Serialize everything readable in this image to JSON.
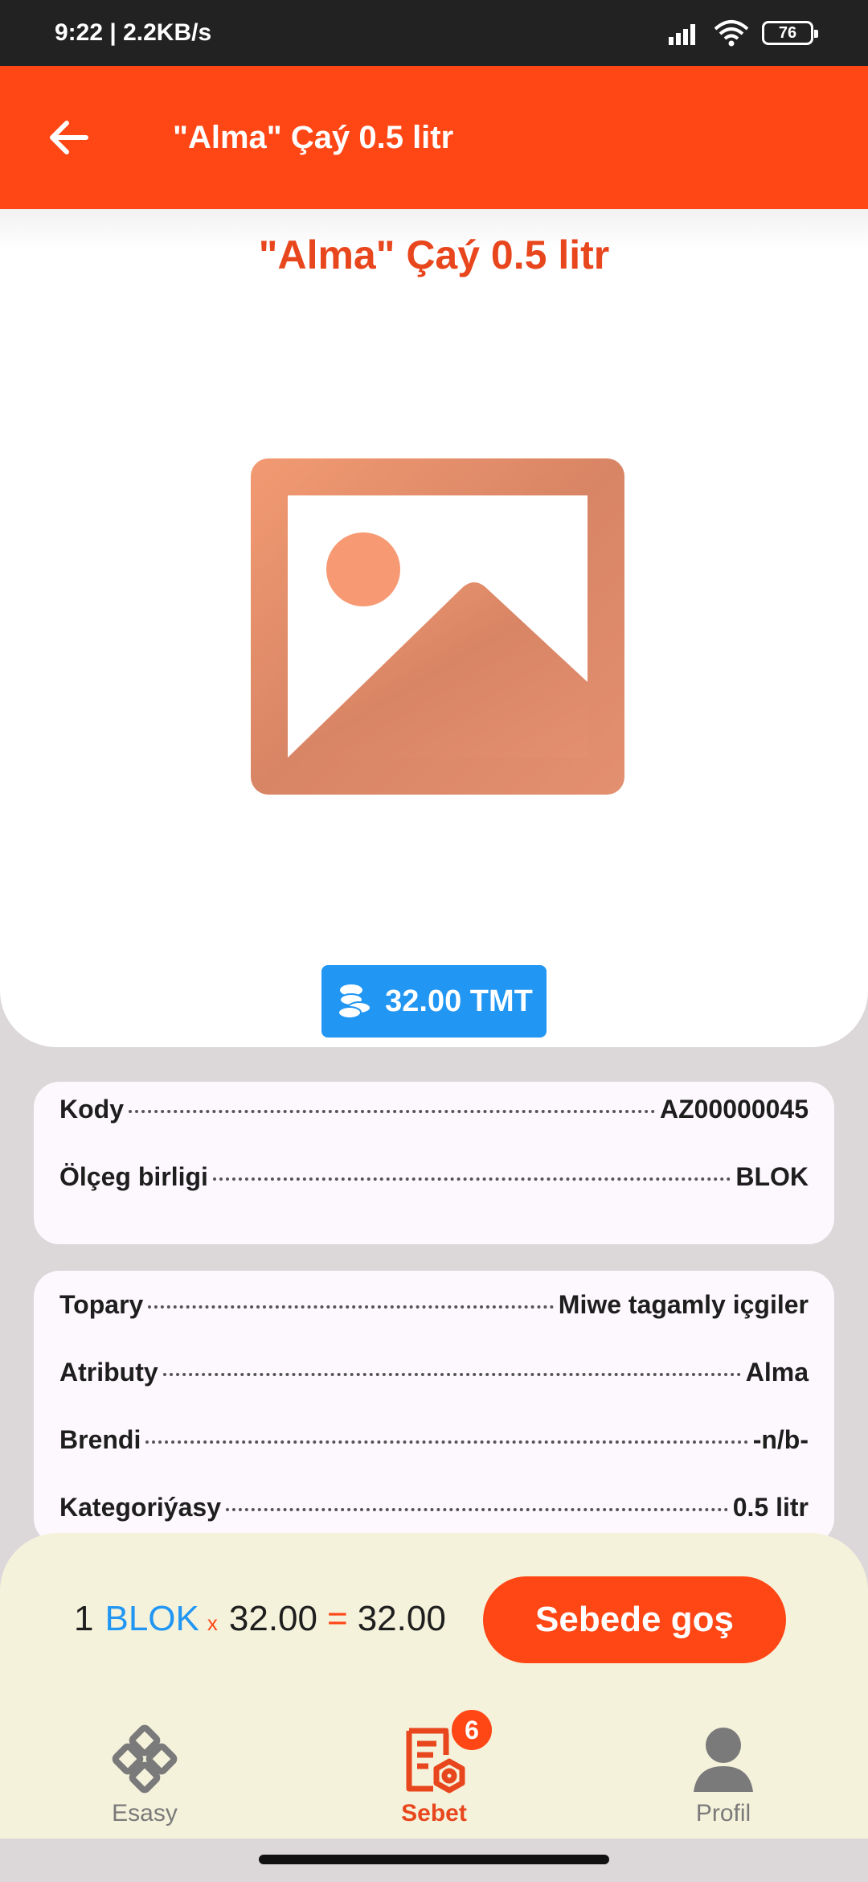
{
  "status_bar": {
    "time_speed": "9:22 | 2.2KB/s",
    "battery": "76",
    "icons": [
      "signal-icon",
      "wifi-icon",
      "battery-icon"
    ]
  },
  "app_bar": {
    "back_icon": "arrow-left-icon",
    "title": "\"Alma\" Çaý 0.5 litr"
  },
  "product": {
    "title": "\"Alma\" Çaý 0.5 litr",
    "image_icon": "image-placeholder-icon",
    "price": "32.00 TMT",
    "price_icon": "coins-icon"
  },
  "info_primary": [
    {
      "label": "Kody",
      "value": "AZ00000045"
    },
    {
      "label": "Ölçeg birligi",
      "value": "BLOK"
    }
  ],
  "info_details": [
    {
      "label": "Topary",
      "value": "Miwe tagamly içgiler"
    },
    {
      "label": "Atributy",
      "value": "Alma"
    },
    {
      "label": "Brendi",
      "value": "-n/b-"
    },
    {
      "label": "Kategoriýasy",
      "value": "0.5 litr"
    }
  ],
  "calc": {
    "qty": "1",
    "unit": "BLOK",
    "mul": "x",
    "price": "32.00",
    "eq": "=",
    "total": "32.00"
  },
  "add_button": "Sebede goş",
  "nav": {
    "home": {
      "label": "Esasy",
      "icon": "home-icon"
    },
    "cart": {
      "label": "Sebet",
      "icon": "cart-icon",
      "badge": "6"
    },
    "profile": {
      "label": "Profil",
      "icon": "profile-icon"
    }
  },
  "colors": {
    "primary": "#ff4615",
    "accent_blue": "#2196f3",
    "sheet": "#f5f2dc"
  }
}
